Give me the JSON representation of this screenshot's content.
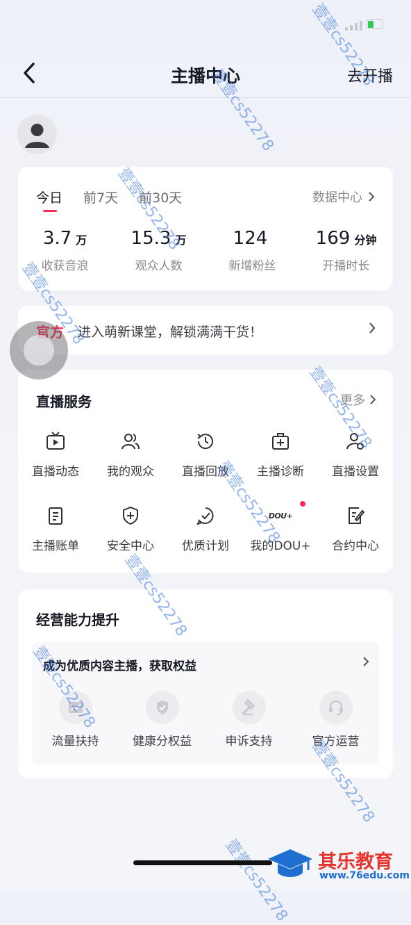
{
  "nav": {
    "title": "主播中心",
    "go_live": "去开播"
  },
  "stats": {
    "tabs": [
      {
        "label": "今日",
        "active": true
      },
      {
        "label": "前7天",
        "active": false
      },
      {
        "label": "前30天",
        "active": false
      }
    ],
    "data_center": "数据中心",
    "metrics": [
      {
        "value": "3.7",
        "unit": "万",
        "label": "收获音浪"
      },
      {
        "value": "15.3",
        "unit": "万",
        "label": "观众人数"
      },
      {
        "value": "124",
        "unit": "",
        "label": "新增粉丝"
      },
      {
        "value": "169",
        "unit": "分钟",
        "label": "开播时长"
      }
    ]
  },
  "banner": {
    "tag": "官方",
    "text": "进入萌新课堂，解锁满满干货！"
  },
  "services": {
    "title": "直播服务",
    "more": "更多",
    "items": [
      {
        "label": "直播动态",
        "icon": "tv-icon"
      },
      {
        "label": "我的观众",
        "icon": "users-icon"
      },
      {
        "label": "直播回放",
        "icon": "replay-clock-icon"
      },
      {
        "label": "主播诊断",
        "icon": "medical-kit-icon"
      },
      {
        "label": "直播设置",
        "icon": "user-settings-icon"
      },
      {
        "label": "主播账单",
        "icon": "bill-icon"
      },
      {
        "label": "安全中心",
        "icon": "shield-plus-icon"
      },
      {
        "label": "优质计划",
        "icon": "check-bubble-icon"
      },
      {
        "label": "我的DOU+",
        "icon": "dou-plus-icon",
        "badge_text": "DOU+"
      },
      {
        "label": "合约中心",
        "icon": "contract-edit-icon"
      }
    ]
  },
  "business": {
    "title": "经营能力提升",
    "subtitle": "成为优质内容主播，获取权益",
    "items": [
      {
        "label": "流量扶持",
        "icon": "trend-chart-icon"
      },
      {
        "label": "健康分权益",
        "icon": "shield-icon"
      },
      {
        "label": "申诉支持",
        "icon": "gavel-icon"
      },
      {
        "label": "官方运营",
        "icon": "headset-icon"
      }
    ]
  },
  "watermark": {
    "text": "壹壹cs52278"
  },
  "brand": {
    "name": "其乐教育",
    "url": "www.76edu.com"
  },
  "colors": {
    "accent": "#fe2c55",
    "text": "#161823",
    "muted": "#8a8b91"
  }
}
